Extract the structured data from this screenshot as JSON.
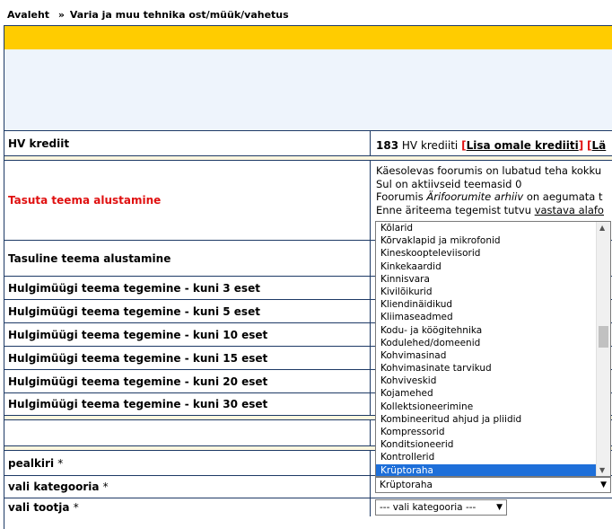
{
  "breadcrumb": {
    "home": "Avaleht",
    "separator": "»",
    "current": "Varia ja muu tehnika ost/müük/vahetus"
  },
  "form": {
    "hv_credit_label": "HV krediit",
    "hv_credit_amount": "183",
    "hv_credit_unit": "HV krediiti",
    "add_credit_link": "Lisa omale krediiti",
    "extra_link": "Lä",
    "free_topic_label": "Tasuta teema alustamine",
    "paid_topic_label": "Tasuline teema alustamine",
    "bulk_labels": [
      "Hulgimüügi teema tegemine - kuni 3 eset",
      "Hulgimüügi teema tegemine - kuni 5 eset",
      "Hulgimüügi teema tegemine - kuni 10 eset",
      "Hulgimüügi teema tegemine - kuni 15 eset",
      "Hulgimüügi teema tegemine - kuni 20 eset",
      "Hulgimüügi teema tegemine - kuni 30 eset"
    ],
    "title_label": "pealkiri",
    "category_label": "vali kategooria",
    "producer_label": "vali tootja",
    "required_mark": "*"
  },
  "info": {
    "line1": "Käesolevas foorumis on lubatud teha kokku",
    "line2": "Sul on aktiivseid teemasid 0",
    "line3_pre": "Foorumis",
    "line3_italic": "Ärifoorumite arhiiv",
    "line3_post": "on aegumata t",
    "line4_pre": "Enne äriteema tegemist tutvu",
    "line4_link": "vastava alafo"
  },
  "category_list": {
    "items": [
      "Kõlarid",
      "Kõrvaklapid ja mikrofonid",
      "Kineskoopteleviisorid",
      "Kinkekaardid",
      "Kinnisvara",
      "Kivilõikurid",
      "Kliendinäidikud",
      "Kliimaseadmed",
      "Kodu- ja köögitehnika",
      "Kodulehed/domeenid",
      "Kohvimasinad",
      "Kohvimasinate tarvikud",
      "Kohviveskid",
      "Kojamehed",
      "Kollektsioneerimine",
      "Kombineeritud ahjud ja pliidid",
      "Kompressorid",
      "Konditsioneerid",
      "Kontrollerid",
      "Krüptoraha"
    ],
    "selected": "Krüptoraha"
  },
  "category_select": {
    "value": "Krüptoraha"
  },
  "producer_select": {
    "value": "--- vali kategooria ---"
  }
}
